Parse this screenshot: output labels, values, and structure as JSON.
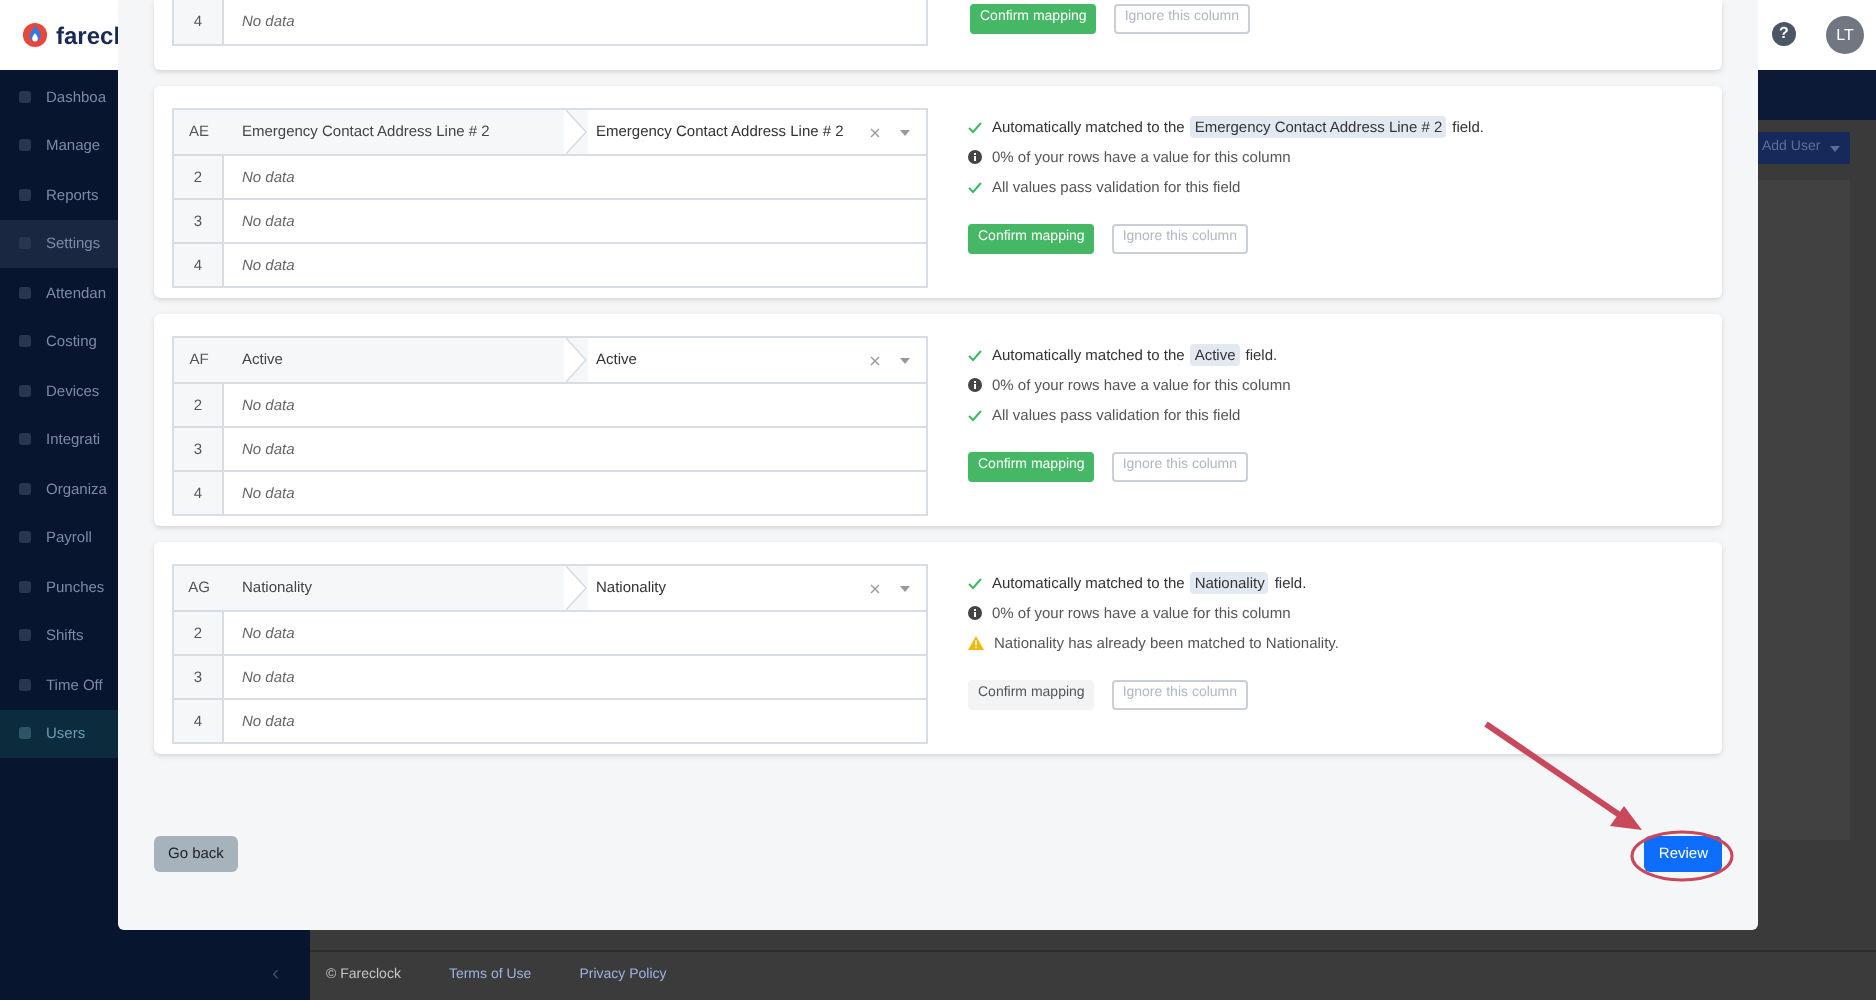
{
  "app": {
    "logo_text": "farecl",
    "sidebar": [
      {
        "label": "Dashboa",
        "selected": false,
        "highlighted": false
      },
      {
        "label": "Manage",
        "selected": false,
        "highlighted": false
      },
      {
        "label": "Reports",
        "selected": false,
        "highlighted": false
      },
      {
        "label": "Settings",
        "selected": false,
        "highlighted": true
      },
      {
        "label": "Attendan",
        "selected": false,
        "highlighted": false
      },
      {
        "label": "Costing",
        "selected": false,
        "highlighted": false
      },
      {
        "label": "Devices",
        "selected": false,
        "highlighted": false
      },
      {
        "label": "Integrati",
        "selected": false,
        "highlighted": false
      },
      {
        "label": "Organiza",
        "selected": false,
        "highlighted": false
      },
      {
        "label": "Payroll",
        "selected": false,
        "highlighted": false
      },
      {
        "label": "Punches",
        "selected": false,
        "highlighted": false
      },
      {
        "label": "Shifts",
        "selected": false,
        "highlighted": false
      },
      {
        "label": "Time Off",
        "selected": false,
        "highlighted": false
      },
      {
        "label": "Users",
        "selected": true,
        "highlighted": false
      }
    ],
    "help": "?",
    "avatar": "LT",
    "add_user": "Add User",
    "collapse": "‹",
    "footer": [
      "© Fareclock",
      "Terms of Use",
      "Privacy Policy"
    ]
  },
  "modal": {
    "cards": [
      {
        "rows": [
          {
            "number": "4",
            "value": "No data"
          }
        ],
        "confirm": {
          "label": "Confirm mapping",
          "disabled": false
        },
        "ignore": "Ignore this column"
      },
      {
        "column": "AE",
        "source": "Emergency Contact Address Line # 2",
        "target": "Emergency Contact Address Line # 2",
        "rows": [
          {
            "number": "2",
            "value": "No data"
          },
          {
            "number": "3",
            "value": "No data"
          },
          {
            "number": "4",
            "value": "No data"
          }
        ],
        "status": [
          {
            "kind": "check",
            "prefix": "Automatically matched to the",
            "field": "Emergency Contact Address Line # 2",
            "suffix": "field."
          },
          {
            "kind": "info",
            "text": "0% of your rows have a value for this column"
          },
          {
            "kind": "check",
            "text": "All values pass validation for this field"
          }
        ],
        "confirm": {
          "label": "Confirm mapping",
          "disabled": false
        },
        "ignore": "Ignore this column"
      },
      {
        "column": "AF",
        "source": "Active",
        "target": "Active",
        "rows": [
          {
            "number": "2",
            "value": "No data"
          },
          {
            "number": "3",
            "value": "No data"
          },
          {
            "number": "4",
            "value": "No data"
          }
        ],
        "status": [
          {
            "kind": "check",
            "prefix": "Automatically matched to the",
            "field": "Active",
            "suffix": "field."
          },
          {
            "kind": "info",
            "text": "0% of your rows have a value for this column"
          },
          {
            "kind": "check",
            "text": "All values pass validation for this field"
          }
        ],
        "confirm": {
          "label": "Confirm mapping",
          "disabled": false
        },
        "ignore": "Ignore this column"
      },
      {
        "column": "AG",
        "source": "Nationality",
        "target": "Nationality",
        "rows": [
          {
            "number": "2",
            "value": "No data"
          },
          {
            "number": "3",
            "value": "No data"
          },
          {
            "number": "4",
            "value": "No data"
          }
        ],
        "status": [
          {
            "kind": "check",
            "prefix": "Automatically matched to the",
            "field": "Nationality",
            "suffix": "field."
          },
          {
            "kind": "info",
            "text": "0% of your rows have a value for this column"
          },
          {
            "kind": "warning",
            "text": "Nationality has already been matched to Nationality."
          }
        ],
        "confirm": {
          "label": "Confirm mapping",
          "disabled": true
        },
        "ignore": "Ignore this column"
      }
    ],
    "go_back": "Go back",
    "review": "Review"
  }
}
